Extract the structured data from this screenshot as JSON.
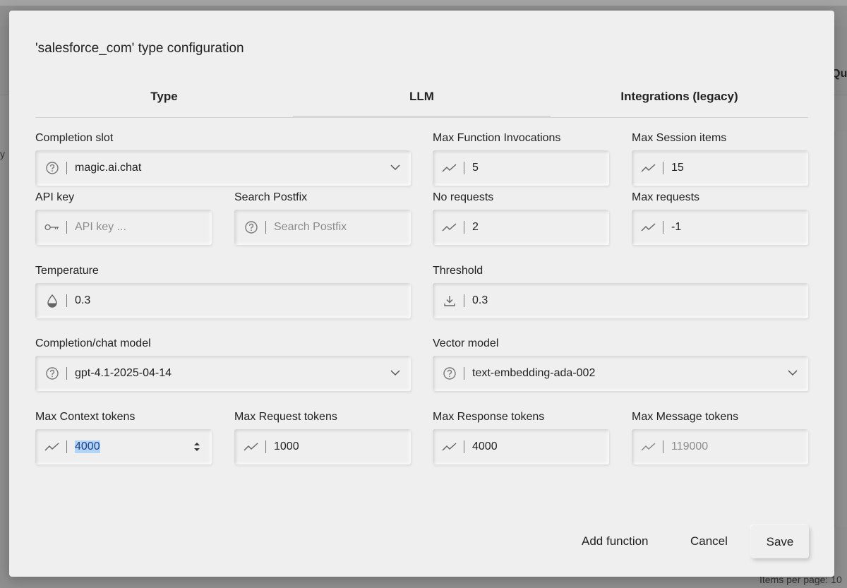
{
  "background": {
    "right_text": "Qu",
    "left_text": "y",
    "footer_text": "Items per page: 10"
  },
  "dialog": {
    "title": "'salesforce_com' type configuration",
    "tabs": [
      {
        "label": "Type",
        "active": false
      },
      {
        "label": "LLM",
        "active": true
      },
      {
        "label": "Integrations (legacy)",
        "active": false
      }
    ],
    "fields": {
      "completion_slot": {
        "label": "Completion slot",
        "value": "magic.ai.chat",
        "icon": "help-circle-icon"
      },
      "max_function_invocations": {
        "label": "Max Function Invocations",
        "value": "5",
        "icon": "trend-icon"
      },
      "max_session_items": {
        "label": "Max Session items",
        "value": "15",
        "icon": "trend-icon"
      },
      "api_key": {
        "label": "API key",
        "placeholder": "API key ...",
        "icon": "key-icon"
      },
      "search_postfix": {
        "label": "Search Postfix",
        "placeholder": "Search Postfix",
        "icon": "help-circle-icon"
      },
      "no_requests": {
        "label": "No requests",
        "value": "2",
        "icon": "trend-icon"
      },
      "max_requests": {
        "label": "Max requests",
        "value": "-1",
        "icon": "trend-icon"
      },
      "temperature": {
        "label": "Temperature",
        "value": "0.3",
        "icon": "drop-icon"
      },
      "threshold": {
        "label": "Threshold",
        "value": "0.3",
        "icon": "download-icon"
      },
      "completion_model": {
        "label": "Completion/chat model",
        "value": "gpt-4.1-2025-04-14",
        "icon": "help-circle-icon"
      },
      "vector_model": {
        "label": "Vector model",
        "value": "text-embedding-ada-002",
        "icon": "help-circle-icon"
      },
      "max_context_tokens": {
        "label": "Max Context tokens",
        "value": "4000",
        "icon": "trend-icon"
      },
      "max_request_tokens": {
        "label": "Max Request tokens",
        "value": "1000",
        "icon": "trend-icon"
      },
      "max_response_tokens": {
        "label": "Max Response tokens",
        "value": "4000",
        "icon": "trend-icon"
      },
      "max_message_tokens": {
        "label": "Max Message tokens",
        "placeholder": "119000",
        "icon": "trend-icon"
      }
    },
    "buttons": {
      "add_function": "Add function",
      "cancel": "Cancel",
      "save": "Save"
    }
  }
}
